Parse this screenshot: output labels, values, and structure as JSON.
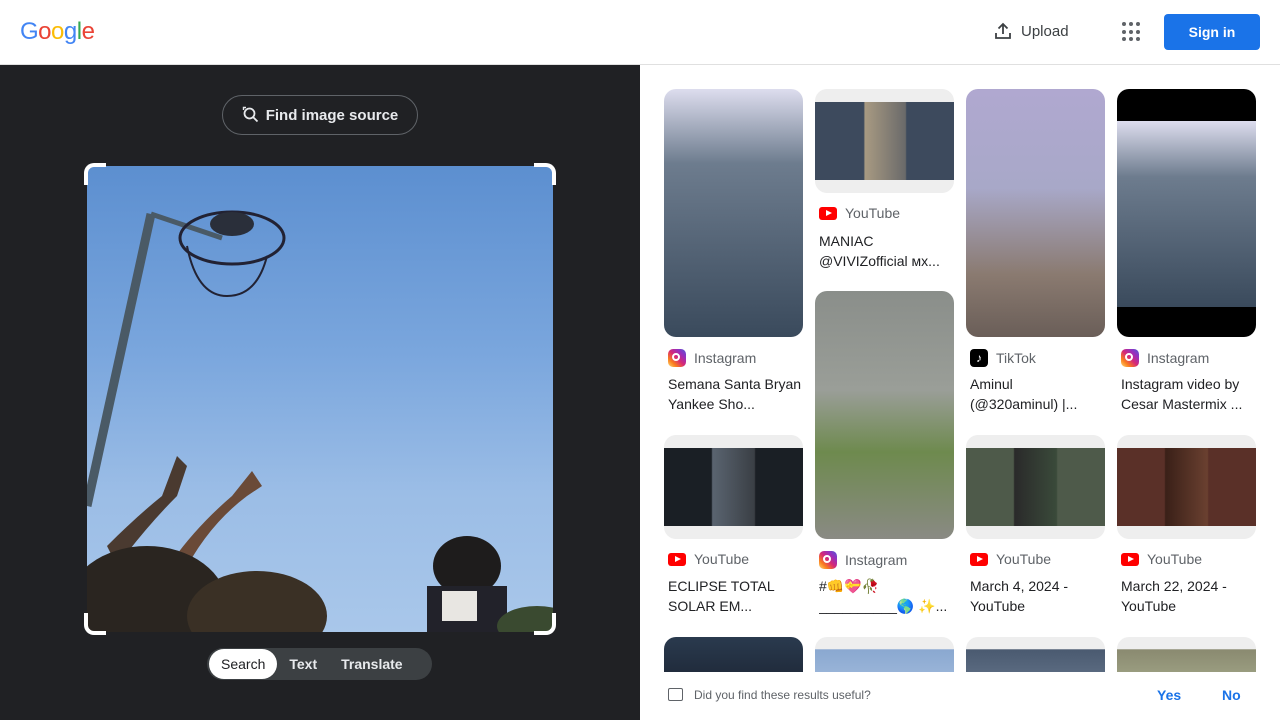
{
  "header": {
    "logo_letters": [
      "G",
      "o",
      "o",
      "g",
      "l",
      "e"
    ],
    "logo_colors": [
      "#4285F4",
      "#EA4335",
      "#FBBC05",
      "#4285F4",
      "#34A853",
      "#EA4335"
    ],
    "upload_label": "Upload",
    "apps_icon": "apps-grid-icon",
    "signin_label": "Sign in"
  },
  "lens": {
    "find_source_label": "Find image source",
    "tabs": [
      {
        "label": "Search",
        "active": true
      },
      {
        "label": "Text",
        "active": false
      },
      {
        "label": "Translate",
        "active": false
      }
    ]
  },
  "results": [
    {
      "source": "Instagram",
      "icon": "instagram-icon",
      "title": "Semana Santa Bryan Yankee Sho...",
      "thumb_colors": [
        "#6d7c8e",
        "#3a4a5c"
      ]
    },
    {
      "source": "YouTube",
      "icon": "youtube-icon",
      "title": "MANIAC @VIVIZofficial мх...",
      "thumb_colors": [
        "#3d4a5d",
        "#a89a82"
      ]
    },
    {
      "source": "TikTok",
      "icon": "tiktok-icon",
      "title": "Aminul (@320aminul) |...",
      "thumb_colors": [
        "#a8a8c8",
        "#7c6e68"
      ]
    },
    {
      "source": "Instagram",
      "icon": "instagram-icon",
      "title": "Instagram video by Cesar Mastermix ...",
      "thumb_colors": [
        "#6d7c8e",
        "#3a4a5c"
      ]
    },
    {
      "source": "YouTube",
      "icon": "youtube-icon",
      "title": "ECLIPSE TOTAL SOLAR EM...",
      "thumb_colors": [
        "#1a1f25",
        "#3a3f45"
      ]
    },
    {
      "source": "Instagram",
      "icon": "instagram-icon",
      "title": "#👊💝🥀 __________🌎 ✨...",
      "thumb_colors": [
        "#8a8e8a",
        "#6e8a4e"
      ]
    },
    {
      "source": "YouTube",
      "icon": "youtube-icon",
      "title": "March 4, 2024 - YouTube",
      "thumb_colors": [
        "#4e5a4a",
        "#2a3a2a"
      ]
    },
    {
      "source": "YouTube",
      "icon": "youtube-icon",
      "title": "March 22, 2024 - YouTube",
      "thumb_colors": [
        "#5a3028",
        "#3a2018"
      ]
    }
  ],
  "feedback": {
    "question": "Did you find these results useful?",
    "yes": "Yes",
    "no": "No"
  }
}
